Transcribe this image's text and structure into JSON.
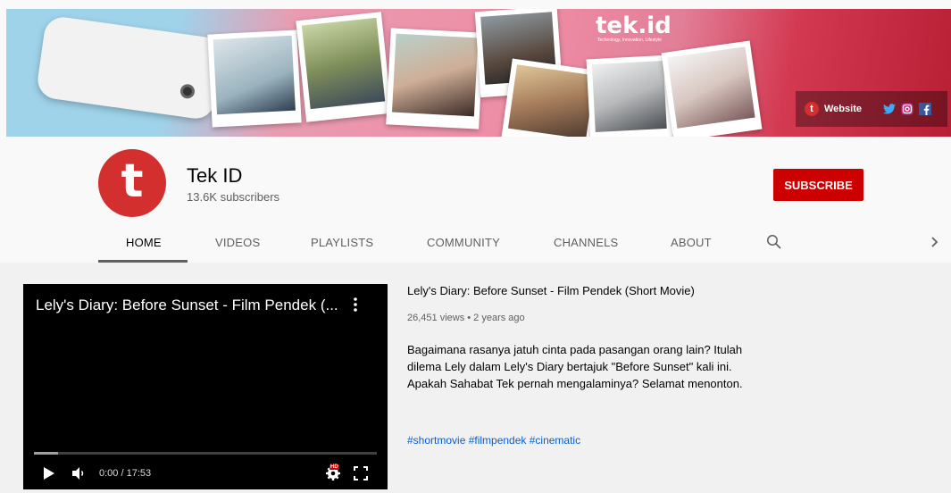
{
  "banner": {
    "brand": "tek.id",
    "brand_tagline": "Technology, Innovation, Lifestyle",
    "links": {
      "website_label": "Website",
      "website_logo": "t",
      "social_icons": [
        "twitter-icon",
        "instagram-icon",
        "facebook-icon"
      ]
    }
  },
  "channel": {
    "avatar_letter": "t",
    "name": "Tek ID",
    "subscribers": "13.6K subscribers",
    "subscribe_label": "SUBSCRIBE"
  },
  "tabs": {
    "home": "HOME",
    "videos": "VIDEOS",
    "playlists": "PLAYLISTS",
    "community": "COMMUNITY",
    "channels": "CHANNELS",
    "about": "ABOUT",
    "active": "HOME"
  },
  "player": {
    "title": "Lely's Diary: Before Sunset - Film Pendek (...",
    "time": "0:00 / 17:53",
    "progress_loaded_fraction": 0.07,
    "hd_badge": "HD"
  },
  "video": {
    "title": "Lely's Diary: Before Sunset - Film Pendek (Short Movie)",
    "meta": "26,451 views • 2 years ago",
    "description": "Bagaimana rasanya jatuh cinta pada pasangan orang lain? Itulah dilema Lely dalam Lely's Diary bertajuk \"Before Sunset\" kali ini. Apakah Sahabat Tek pernah mengalaminya? Selamat menonton.",
    "tags": "#shortmovie #filmpendek #cinematic"
  },
  "colors": {
    "brand_red": "#cc0000",
    "avatar_red": "#d32f2f",
    "link_blue": "#065fd4"
  }
}
